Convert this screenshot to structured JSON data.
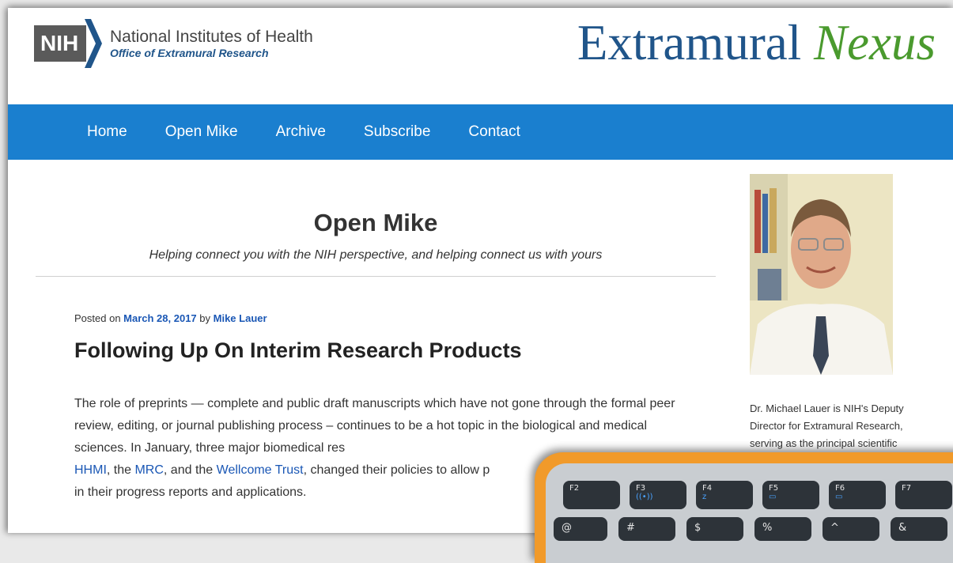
{
  "header": {
    "logo_abbr": "NIH",
    "logo_line1": "National Institutes of Health",
    "logo_line2": "Office of Extramural Research",
    "brand_main": "Extramural",
    "brand_accent": "Nexus"
  },
  "nav": {
    "items": [
      "Home",
      "Open Mike",
      "Archive",
      "Subscribe",
      "Contact"
    ]
  },
  "section": {
    "title": "Open Mike",
    "subtitle": "Helping connect you with the NIH perspective, and helping connect us with yours"
  },
  "post": {
    "posted_prefix": "Posted on ",
    "date": "March 28, 2017",
    "by": " by ",
    "author": "Mike Lauer",
    "title": "Following Up On Interim Research Products",
    "p1_a": "The role of preprints — complete and public draft manuscripts which have not gone through the formal peer review, editing, or journal publishing process – continues to be a hot topic in the biological and medical sciences. In January, three major biomedical res",
    "link1": "HHMI",
    "sep1": ", the ",
    "link2": "MRC",
    "sep2": ", and the ",
    "link3": "Wellcome Trust",
    "p1_b": ", changed their policies to allow p",
    "p1_c": "in their progress reports and applications."
  },
  "sidebar": {
    "bio": "Dr. Michael Lauer is NIH's Deputy Director for Extramural Research, serving as the principal scientific"
  },
  "keyboard": {
    "fkeys": [
      {
        "label": "F2",
        "sub": ""
      },
      {
        "label": "F3",
        "sub": "((•))"
      },
      {
        "label": "F4",
        "sub": "z"
      },
      {
        "label": "F5",
        "sub": "▭"
      },
      {
        "label": "F6",
        "sub": "▭"
      },
      {
        "label": "F7",
        "sub": ""
      }
    ],
    "row2": [
      "@",
      "#",
      "$",
      "%",
      "^",
      "&"
    ]
  },
  "colors": {
    "nav_bg": "#1a7fcf",
    "brand_blue": "#20558a",
    "brand_green": "#4a9a2e",
    "link": "#1a57b5",
    "keyboard_frame": "#f19a2a"
  }
}
